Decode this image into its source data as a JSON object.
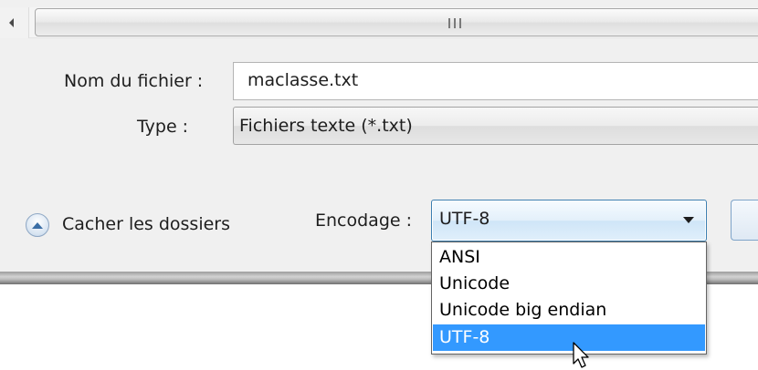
{
  "scrollbar": {
    "grip": "III"
  },
  "filename": {
    "label": "Nom du fichier :",
    "value": "maclasse.txt"
  },
  "filetype": {
    "label": "Type :",
    "value": "Fichiers texte (*.txt)"
  },
  "hide_folders": {
    "label": "Cacher les dossiers",
    "icon": "chevron-up-circle-icon"
  },
  "encoding": {
    "label": "Encodage :",
    "selected": "UTF-8",
    "options": [
      "ANSI",
      "Unicode",
      "Unicode big endian",
      "UTF-8"
    ],
    "highlighted_index": 3
  },
  "colors": {
    "highlight": "#3399ff",
    "focus_border": "#3c7fb1",
    "dialog_bg": "#f0f0f0"
  }
}
